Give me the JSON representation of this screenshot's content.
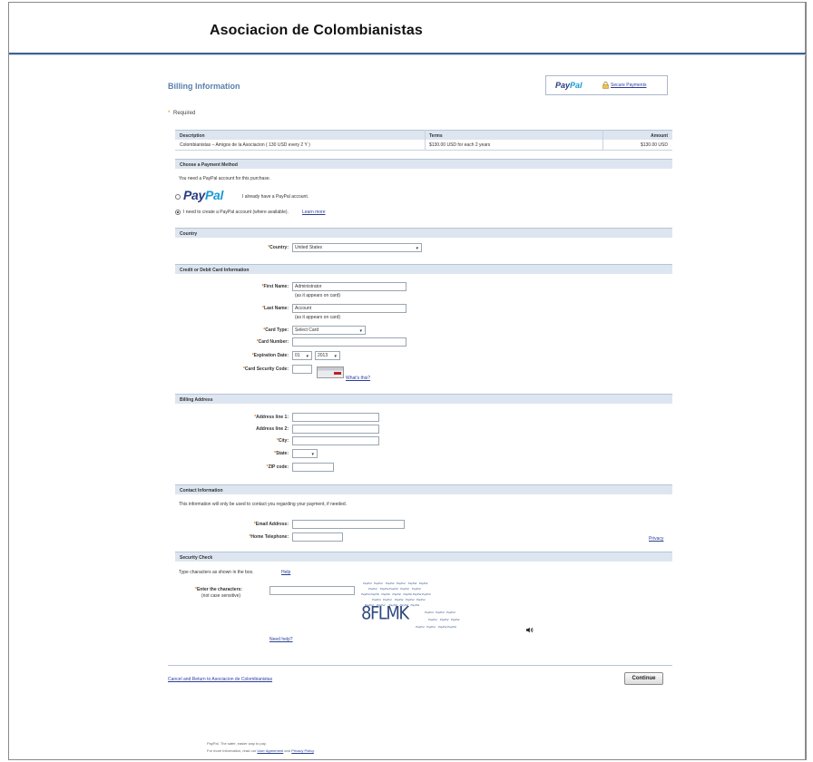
{
  "header": {
    "title": "Asociacion de Colombianistas"
  },
  "billing": {
    "title": "Billing Information",
    "paypal_logo_pay": "Pay",
    "paypal_logo_pal": "Pal",
    "secure_label": "Secure Payments",
    "required_star": "*",
    "required_label": "Required"
  },
  "summary": {
    "headers": [
      "Description",
      "Terms",
      "Amount"
    ],
    "row": [
      "Colombianistas – Amigos de la Asociacion ( 130 USD every 2 Y )",
      "$130.00 USD for each 2 years",
      "$130.00 USD"
    ]
  },
  "payment": {
    "section": "Choose a Payment Method",
    "intro": "You need a PayPal account for this purchase.",
    "paypal_pay": "Pay",
    "paypal_pal": "Pal",
    "option1": "I already have a PayPal account.",
    "option2": "I need to create a PayPal account (where available).",
    "learn_more": "Learn more"
  },
  "country": {
    "section": "Country",
    "label": "Country:",
    "value": "United States"
  },
  "card": {
    "section": "Credit or Debit Card Information",
    "first_name_label": "First Name:",
    "first_name_value": "Administrator",
    "first_name_note": "(as it appears on card)",
    "last_name_label": "Last Name:",
    "last_name_value": "Account",
    "last_name_note": "(as it appears on card)",
    "card_type_label": "Card Type:",
    "card_type_value": "Select Card",
    "card_number_label": "Card Number:",
    "expiration_label": "Expiration Date:",
    "exp_month": "01",
    "exp_year": "2013",
    "security_label": "Card Security Code:",
    "whats_this": "What's this?"
  },
  "billing_address": {
    "section": "Billing Address",
    "line1_label": "Address line 1:",
    "line2_label": "Address line 2:",
    "city_label": "City:",
    "state_label": "State:",
    "zip_label": "ZIP code:"
  },
  "contact": {
    "section": "Contact Information",
    "intro": "This information will only be used to contact you regarding your payment, if needed.",
    "email_label": "Email Address:",
    "phone_label": "Home Telephone:",
    "privacy": "Privacy"
  },
  "security": {
    "section": "Security Check",
    "intro": "Type characters as shown in the box.",
    "help": "Help",
    "enter_label": "Enter the characters:",
    "case_note": "(not case sensitive)",
    "captcha_text": "8FLMK",
    "need_help": "Need help?"
  },
  "footer": {
    "cancel_link": "Cancel and Return to Asociacion de Colombianistas",
    "continue": "Continue",
    "note1": "PayPal. The safer, easier way to pay.",
    "note2_a": "For more information, read our",
    "note2_link1": "User Agreement",
    "note2_b": "and",
    "note2_link2": "Privacy Policy",
    "note2_end": "."
  }
}
